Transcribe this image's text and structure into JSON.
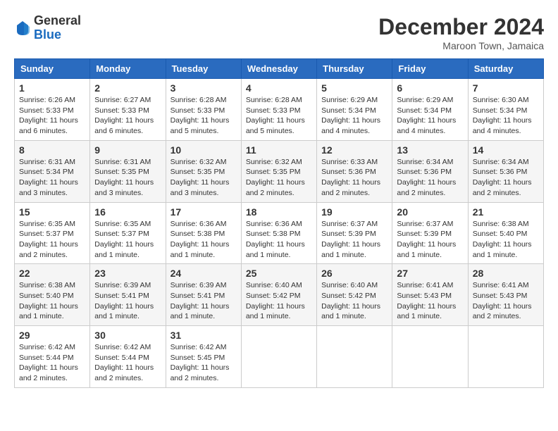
{
  "logo": {
    "general": "General",
    "blue": "Blue"
  },
  "title": "December 2024",
  "location": "Maroon Town, Jamaica",
  "headers": [
    "Sunday",
    "Monday",
    "Tuesday",
    "Wednesday",
    "Thursday",
    "Friday",
    "Saturday"
  ],
  "weeks": [
    [
      {
        "day": "1",
        "sunrise": "6:26 AM",
        "sunset": "5:33 PM",
        "daylight": "11 hours and 6 minutes."
      },
      {
        "day": "2",
        "sunrise": "6:27 AM",
        "sunset": "5:33 PM",
        "daylight": "11 hours and 6 minutes."
      },
      {
        "day": "3",
        "sunrise": "6:28 AM",
        "sunset": "5:33 PM",
        "daylight": "11 hours and 5 minutes."
      },
      {
        "day": "4",
        "sunrise": "6:28 AM",
        "sunset": "5:33 PM",
        "daylight": "11 hours and 5 minutes."
      },
      {
        "day": "5",
        "sunrise": "6:29 AM",
        "sunset": "5:34 PM",
        "daylight": "11 hours and 4 minutes."
      },
      {
        "day": "6",
        "sunrise": "6:29 AM",
        "sunset": "5:34 PM",
        "daylight": "11 hours and 4 minutes."
      },
      {
        "day": "7",
        "sunrise": "6:30 AM",
        "sunset": "5:34 PM",
        "daylight": "11 hours and 4 minutes."
      }
    ],
    [
      {
        "day": "8",
        "sunrise": "6:31 AM",
        "sunset": "5:34 PM",
        "daylight": "11 hours and 3 minutes."
      },
      {
        "day": "9",
        "sunrise": "6:31 AM",
        "sunset": "5:35 PM",
        "daylight": "11 hours and 3 minutes."
      },
      {
        "day": "10",
        "sunrise": "6:32 AM",
        "sunset": "5:35 PM",
        "daylight": "11 hours and 3 minutes."
      },
      {
        "day": "11",
        "sunrise": "6:32 AM",
        "sunset": "5:35 PM",
        "daylight": "11 hours and 2 minutes."
      },
      {
        "day": "12",
        "sunrise": "6:33 AM",
        "sunset": "5:36 PM",
        "daylight": "11 hours and 2 minutes."
      },
      {
        "day": "13",
        "sunrise": "6:34 AM",
        "sunset": "5:36 PM",
        "daylight": "11 hours and 2 minutes."
      },
      {
        "day": "14",
        "sunrise": "6:34 AM",
        "sunset": "5:36 PM",
        "daylight": "11 hours and 2 minutes."
      }
    ],
    [
      {
        "day": "15",
        "sunrise": "6:35 AM",
        "sunset": "5:37 PM",
        "daylight": "11 hours and 2 minutes."
      },
      {
        "day": "16",
        "sunrise": "6:35 AM",
        "sunset": "5:37 PM",
        "daylight": "11 hours and 1 minute."
      },
      {
        "day": "17",
        "sunrise": "6:36 AM",
        "sunset": "5:38 PM",
        "daylight": "11 hours and 1 minute."
      },
      {
        "day": "18",
        "sunrise": "6:36 AM",
        "sunset": "5:38 PM",
        "daylight": "11 hours and 1 minute."
      },
      {
        "day": "19",
        "sunrise": "6:37 AM",
        "sunset": "5:39 PM",
        "daylight": "11 hours and 1 minute."
      },
      {
        "day": "20",
        "sunrise": "6:37 AM",
        "sunset": "5:39 PM",
        "daylight": "11 hours and 1 minute."
      },
      {
        "day": "21",
        "sunrise": "6:38 AM",
        "sunset": "5:40 PM",
        "daylight": "11 hours and 1 minute."
      }
    ],
    [
      {
        "day": "22",
        "sunrise": "6:38 AM",
        "sunset": "5:40 PM",
        "daylight": "11 hours and 1 minute."
      },
      {
        "day": "23",
        "sunrise": "6:39 AM",
        "sunset": "5:41 PM",
        "daylight": "11 hours and 1 minute."
      },
      {
        "day": "24",
        "sunrise": "6:39 AM",
        "sunset": "5:41 PM",
        "daylight": "11 hours and 1 minute."
      },
      {
        "day": "25",
        "sunrise": "6:40 AM",
        "sunset": "5:42 PM",
        "daylight": "11 hours and 1 minute."
      },
      {
        "day": "26",
        "sunrise": "6:40 AM",
        "sunset": "5:42 PM",
        "daylight": "11 hours and 1 minute."
      },
      {
        "day": "27",
        "sunrise": "6:41 AM",
        "sunset": "5:43 PM",
        "daylight": "11 hours and 1 minute."
      },
      {
        "day": "28",
        "sunrise": "6:41 AM",
        "sunset": "5:43 PM",
        "daylight": "11 hours and 2 minutes."
      }
    ],
    [
      {
        "day": "29",
        "sunrise": "6:42 AM",
        "sunset": "5:44 PM",
        "daylight": "11 hours and 2 minutes."
      },
      {
        "day": "30",
        "sunrise": "6:42 AM",
        "sunset": "5:44 PM",
        "daylight": "11 hours and 2 minutes."
      },
      {
        "day": "31",
        "sunrise": "6:42 AM",
        "sunset": "5:45 PM",
        "daylight": "11 hours and 2 minutes."
      },
      null,
      null,
      null,
      null
    ]
  ]
}
